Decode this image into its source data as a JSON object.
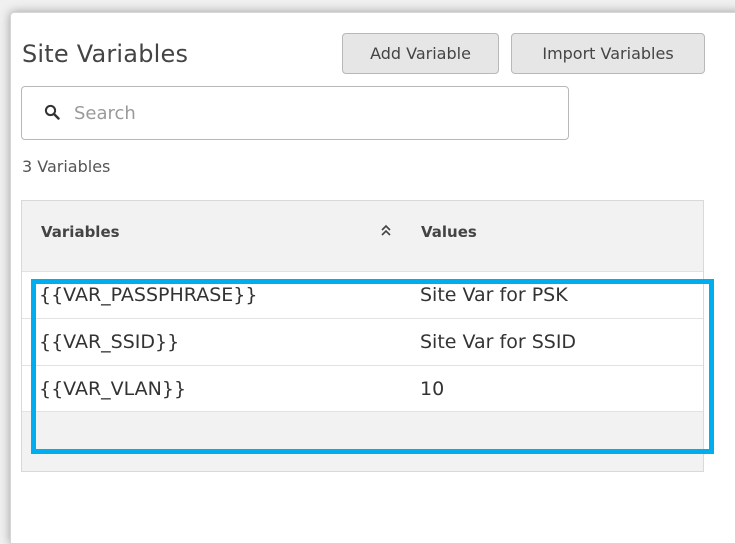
{
  "panel": {
    "title": "Site Variables",
    "add_button": "Add Variable",
    "import_button": "Import Variables"
  },
  "search": {
    "placeholder": "Search"
  },
  "count_text": "3 Variables",
  "table": {
    "columns": [
      "Variables",
      "Values"
    ],
    "rows": [
      {
        "variable": "{{VAR_PASSPHRASE}}",
        "value": "Site Var for PSK"
      },
      {
        "variable": "{{VAR_SSID}}",
        "value": "Site Var for SSID"
      },
      {
        "variable": "{{VAR_VLAN}}",
        "value": "10"
      }
    ]
  },
  "colors": {
    "highlight": "#00aeef",
    "button_bg": "#e6e6e6",
    "header_bg": "#f2f2f2"
  },
  "icons": {
    "search": "search-icon",
    "sort": "double-chevron-up-icon"
  }
}
